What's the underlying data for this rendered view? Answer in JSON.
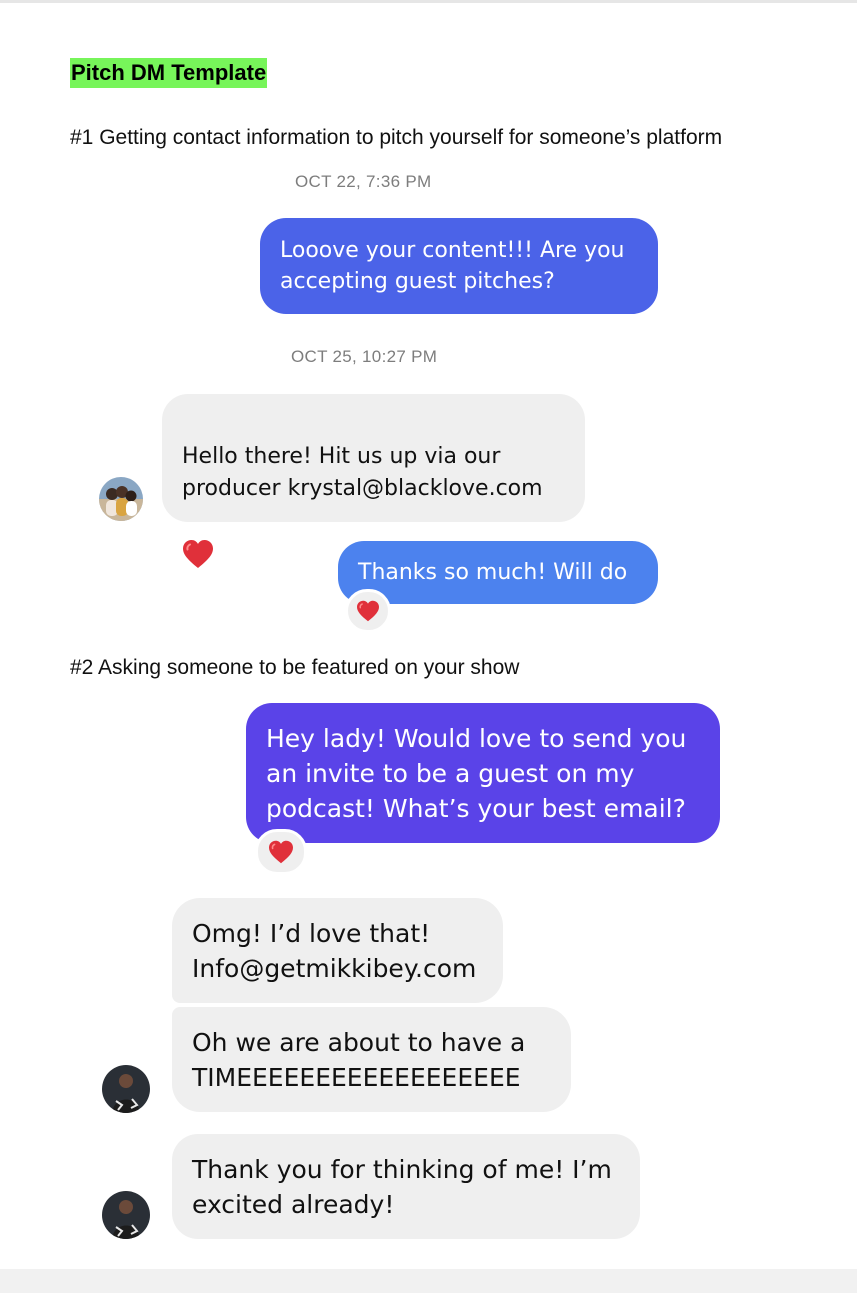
{
  "document": {
    "title": "Pitch DM Template",
    "sections": [
      {
        "heading": "#1 Getting contact information to pitch yourself for someone’s platform",
        "timestamps": [
          "OCT 22, 7:36 PM",
          "OCT 25, 10:27 PM"
        ],
        "messages": [
          {
            "from": "me",
            "text": "Looove your content!!! Are you\naccepting guest pitches?"
          },
          {
            "from": "them",
            "text": "Hello there! Hit us up via our\nproducer krystal@blacklove.com"
          },
          {
            "from": "me",
            "text": "Thanks so much! Will do"
          }
        ]
      },
      {
        "heading": "#2 Asking someone to be featured on your show",
        "messages": [
          {
            "from": "me",
            "text": "Hey lady! Would love to send you\nan invite to be a guest on my\npodcast! What’s your best email?"
          },
          {
            "from": "them",
            "text": "Omg! I’d love that!\nInfo@getmikkibey.com"
          },
          {
            "from": "them",
            "text": "Oh we are about to have a\nTIMEEEEEEEEEEEEEEEEEE"
          },
          {
            "from": "them",
            "text": "Thank you for thinking of me! I’m\nexcited already!"
          }
        ]
      }
    ]
  },
  "colors": {
    "highlight": "#77f55a",
    "outgoing_blue": "#4b63e8",
    "outgoing_light_blue": "#4c82ee",
    "outgoing_purple": "#5a43e8",
    "incoming_gray": "#efefef",
    "heart": "#e0303a"
  },
  "icons": {
    "reaction": "heart-icon",
    "avatar": "avatar-photo"
  }
}
